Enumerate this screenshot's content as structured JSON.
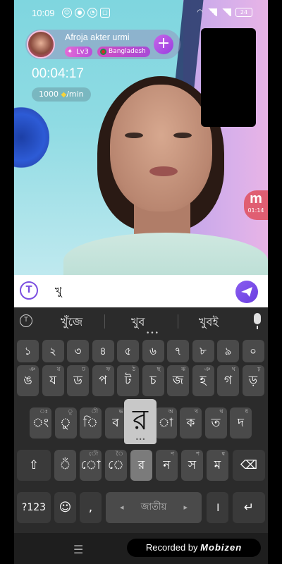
{
  "status_bar": {
    "time": "10:09",
    "battery": "24"
  },
  "host": {
    "name": "Afroja akter urmi",
    "level": "Lv3",
    "country": "Bangladesh",
    "add_label": "+"
  },
  "call": {
    "timer": "00:04:17",
    "rate_amount": "1000",
    "rate_unit": "/min"
  },
  "side_badge": {
    "letter": "m",
    "time": "01:14"
  },
  "input": {
    "value": "খু",
    "translate_label": "T"
  },
  "keyboard": {
    "suggestions": [
      "খুঁজে",
      "খুব",
      "খুবই"
    ],
    "row_numbers": [
      {
        "main": "১",
        "sub": ""
      },
      {
        "main": "২",
        "sub": ""
      },
      {
        "main": "৩",
        "sub": ""
      },
      {
        "main": "৪",
        "sub": ""
      },
      {
        "main": "৫",
        "sub": ""
      },
      {
        "main": "৬",
        "sub": ""
      },
      {
        "main": "৭",
        "sub": ""
      },
      {
        "main": "৮",
        "sub": ""
      },
      {
        "main": "৯",
        "sub": ""
      },
      {
        "main": "০",
        "sub": ""
      }
    ],
    "row1": [
      {
        "main": "ঙ",
        "sub": "ঞ"
      },
      {
        "main": "য",
        "sub": "য়"
      },
      {
        "main": "ড",
        "sub": "ঢ"
      },
      {
        "main": "প",
        "sub": "ফ"
      },
      {
        "main": "ট",
        "sub": "ঠ"
      },
      {
        "main": "চ",
        "sub": "ছ"
      },
      {
        "main": "জ",
        "sub": "ঝ"
      },
      {
        "main": "হ",
        "sub": "ঞ"
      },
      {
        "main": "গ",
        "sub": "ঘ"
      },
      {
        "main": "ড়",
        "sub": "ঢ়"
      }
    ],
    "row2": [
      {
        "main": "ং",
        "sub": "ঃ"
      },
      {
        "main": "ু",
        "sub": "ূ"
      },
      {
        "main": "ি",
        "sub": "ী"
      },
      {
        "main": "ব",
        "sub": "ভ"
      },
      {
        "main": "র",
        "sub": ""
      },
      {
        "main": "া",
        "sub": "অ"
      },
      {
        "main": "ক",
        "sub": "খ"
      },
      {
        "main": "ত",
        "sub": "থ"
      },
      {
        "main": "দ",
        "sub": "ধ"
      }
    ],
    "row3": [
      {
        "main": "ঁ",
        "sub": ""
      },
      {
        "main": "ো",
        "sub": "ৌ"
      },
      {
        "main": "ে",
        "sub": "ৈ"
      },
      {
        "main": "র",
        "sub": ""
      },
      {
        "main": "ন",
        "sub": "ণ"
      },
      {
        "main": "স",
        "sub": "শ"
      },
      {
        "main": "ম",
        "sub": "ষ"
      }
    ],
    "popup_key": "র",
    "symbols_label": "?123",
    "comma_label": ",",
    "space_label": "জাতীয়",
    "period_label": "।"
  },
  "watermark": {
    "prefix": "Recorded by",
    "brand": "Mobizen"
  },
  "colors": {
    "accent": "#7b4fe0",
    "keyboard_bg": "#2b2b2b",
    "key_bg": "#4a4a4a"
  }
}
